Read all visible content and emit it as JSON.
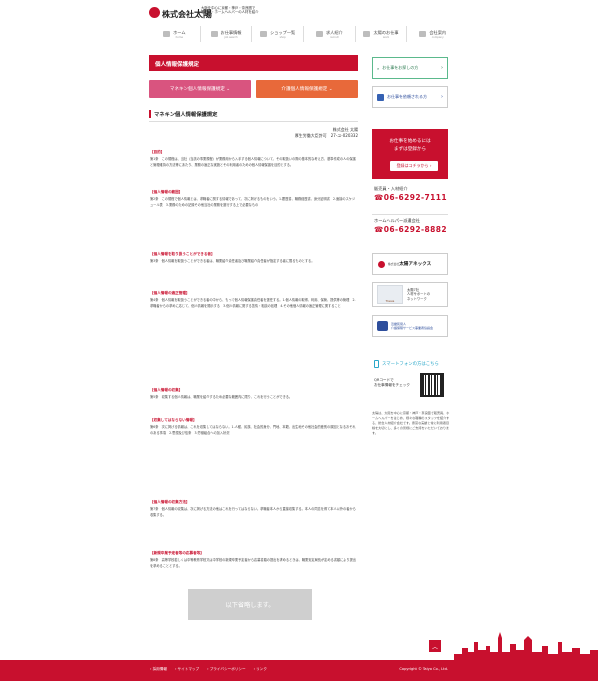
{
  "header": {
    "company": "株式会社",
    "company_bold": "太陽",
    "tagline": [
      "大阪を中心に京都・神戸・奈良圏で",
      "販売員・ホームヘルパーの人材を紹介"
    ]
  },
  "nav": [
    {
      "ja": "ホーム",
      "en": "home"
    },
    {
      "ja": "お仕事情報",
      "en": "job search"
    },
    {
      "ja": "ショップ一覧",
      "en": "shop"
    },
    {
      "ja": "求人紹介",
      "en": "recruit"
    },
    {
      "ja": "太陽のお仕事",
      "en": "work"
    },
    {
      "ja": "会社案内",
      "en": "company"
    }
  ],
  "banner": "個人情報保護規定",
  "buttons": {
    "mannequin": "マネキン個人情報保護規定 ⌄",
    "care": "介護個人情報保護規定 ⌄"
  },
  "section_title": "マネキン個人情報保護規定",
  "issuer": {
    "name": "株式会社 太陽",
    "permit": "厚生労働大臣許可　27-ユ-020332"
  },
  "paragraphs": [
    {
      "heading": "【目的】",
      "text": "第1条　この規程は、当社（当該の事業規程）が業務用から入手する個人情報について、その取扱いの際の基本的な考え方、基準作成の人の保護と管理維持の方法等にあたり、業務の適正な実施とその利用者のための個人情報保護を目的とする。"
    },
    {
      "heading": "【個人情報の範囲】",
      "text": "第2条　この規程で個人情報とは、求職者に関する情報であって、次に掲げるものをいう。1.履歴書、職務経歴書、身分証明書　2.面接のスケジュール表　3.業務のための記録その他当社の業務を遂行する上で必要なもの"
    },
    {
      "heading": "【個人情報を取り扱うことができる者】",
      "text": "第3条　個人情報を取扱うことができる者は、職業紹介責任者及び職業紹介責任者が指定する者に限るものとする。"
    },
    {
      "heading": "【個人情報の適正管理】",
      "text": "第4条　個人情報を取扱うことができる者の中から、もって個人情報保護責任者を選任する。1.個人情報の取得、利用、保管、提供等の管理　2.求職者からの求めに応じて、個人情報を開示する　3.個人情報に関する苦情・相談の処理　4.その他個人情報の適正管理に関すること"
    },
    {
      "heading": "【個人情報の収集】",
      "text": "第5条　収集する個人情報は、職業を紹介するため必要な範囲内に限り、これを行うことができる。"
    },
    {
      "heading": "【収集してはならない情報】",
      "text": "第6条　次に掲げる情報は、これを収集してはならない。1.人種、民族、社会的身分、門地、本籍、出生地その他社会的差別の原因となるおそれのある事項　2.思想及び信条　3.労働組合への加入状況"
    },
    {
      "heading": "【個人情報の収集方法】",
      "text": "第7条　個人情報の収集は、次に掲げる方法の他はこれを行ってはならない。求職者本人から直接収集する。本人の同意を得て本人以外の者から収集する。"
    },
    {
      "heading": "【新規卒業予定者等の応募者等】",
      "text": "第8条　高等学校若しくは中等教育学校又は中学校の新規卒業予定者から応募書類の提出を求めるときは、職業安定局長が定める書類により提出を求めることとする。"
    }
  ],
  "more_label": "以下省略します。",
  "sidebar": {
    "search_job": "お仕事をお探しの方",
    "job_request": "お仕事を依頼される方",
    "red_box": {
      "line1": "お仕事を始めるには",
      "line2": "まずは登録から",
      "button": "登録はコチラから ›"
    },
    "tel1_label": "販売員・入材紹介",
    "tel1": "☎06-6292-7111",
    "tel2_label": "ホームヘルパー派遣会社",
    "tel2": "☎06-6292-8882",
    "annex": {
      "small": "株式会社",
      "name": "太陽アネックス"
    },
    "tresia": {
      "brand": "Tresia",
      "line1": "太陽7社",
      "line2": "人材サポートの",
      "line3": "ネットワーク"
    },
    "association": {
      "line1": "近畿民間人",
      "line2": "介護保険サービス事業者協議会"
    },
    "smartphone": "スマートフォンの方はこちら",
    "qr_text": [
      "QRコードで",
      "お仕事情報をチェック"
    ],
    "description": "太陽は、大阪を中心に京都・神戸・奈良圏で販売員、ホームヘルパーをはじめ、様々な職種のスタッフを紹介する、総合人材紹介会社です。豊富な実績と常に利用者目線を大切にし、多くの皆様にご支持をいただいております。"
  },
  "footer": {
    "links": [
      "› 採用情報",
      "› サイトマップ",
      "› プライバシーポリシー",
      "› リンク"
    ],
    "copyright": "Copyright © Taiyo Co., Ltd."
  },
  "colors": {
    "brand_red": "#c8102e",
    "pink": "#d9547f",
    "orange": "#e8693a",
    "green": "#5bb98c",
    "blue": "#2e4e9c"
  }
}
